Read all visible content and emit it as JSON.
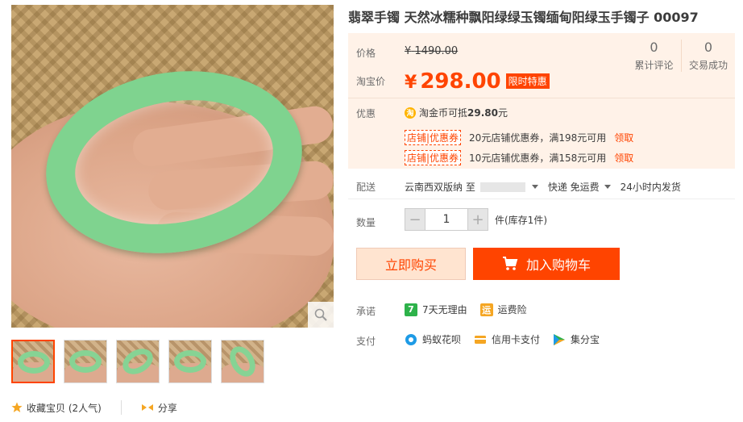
{
  "product": {
    "title": "翡翠手镯 天然冰糯种飘阳绿绿玉镯缅甸阳绿玉手镯子 00097"
  },
  "price": {
    "label": "价格",
    "currency": "¥",
    "original": "1490.00",
    "tb_label": "淘宝价",
    "tb_price": "298.00",
    "tag": "限时特惠"
  },
  "stats": [
    {
      "count": "0",
      "label": "累计评论"
    },
    {
      "count": "0",
      "label": "交易成功"
    }
  ],
  "promo": {
    "label": "优惠",
    "coin_icon_char": "淘",
    "coin_text_prefix": "淘金币可抵",
    "coin_amount": "29.80",
    "coin_unit": "元",
    "coupons": [
      {
        "badge": "店铺|优惠券",
        "desc": "20元店铺优惠券，满198元可用",
        "action": "领取"
      },
      {
        "badge": "店铺|优惠券",
        "desc": "10元店铺优惠券，满158元可用",
        "action": "领取"
      }
    ]
  },
  "shipping": {
    "label": "配送",
    "from": "云南西双版纳 至",
    "method": "快递 免运费",
    "dispatch": "24小时内发货"
  },
  "quantity": {
    "label": "数量",
    "minus": "−",
    "value": "1",
    "plus": "+",
    "stock": "件(库存1件)"
  },
  "actions": {
    "buy_now": "立即购买",
    "add_to_cart": "加入购物车"
  },
  "promise": {
    "label": "承诺",
    "items": [
      {
        "icon": "seven-days-icon",
        "icon_char": "7",
        "text": "7天无理由",
        "color": "#2db24a"
      },
      {
        "icon": "shipping-insurance-icon",
        "icon_char": "运",
        "text": "运费险",
        "color": "#f5a623"
      }
    ]
  },
  "payment": {
    "label": "支付",
    "items": [
      {
        "icon": "huabei-icon",
        "text": "蚂蚁花呗",
        "color": "#1e9be6"
      },
      {
        "icon": "credit-card-icon",
        "text": "信用卡支付",
        "color": "#f5a623"
      },
      {
        "icon": "jifenbao-icon",
        "text": "集分宝",
        "color": "#2db24a"
      }
    ]
  },
  "social": {
    "favorite": "收藏宝贝 (2人气)",
    "share": "分享"
  },
  "colors": {
    "accent": "#ff4400",
    "price_bg": "#fff2e8"
  }
}
